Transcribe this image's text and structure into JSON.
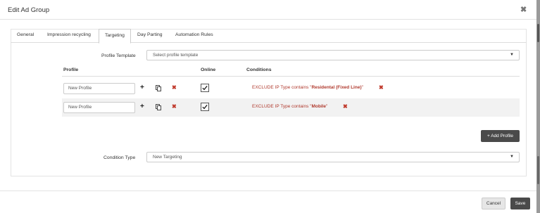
{
  "modal": {
    "title": "Edit Ad Group",
    "close_glyph": "✖"
  },
  "tabs": [
    {
      "label": "General"
    },
    {
      "label": "Impression recycling"
    },
    {
      "label": "Targeting"
    },
    {
      "label": "Day Parting"
    },
    {
      "label": "Automation Rules"
    }
  ],
  "active_tab": "Targeting",
  "profile_template": {
    "label": "Profile Template",
    "placeholder": "Select profile template"
  },
  "table": {
    "headers": {
      "profile": "Profile",
      "online": "Online",
      "conditions": "Conditions"
    },
    "rows": [
      {
        "profile_value": "New Profile",
        "online": true,
        "condition_prefix": "EXCLUDE IP Type contains \"",
        "condition_value": "Residental (Fixed Line)",
        "condition_suffix": "\""
      },
      {
        "profile_value": "New Profile",
        "online": true,
        "condition_prefix": "EXCLUDE IP Type contains \"",
        "condition_value": "Mobile",
        "condition_suffix": "\""
      }
    ]
  },
  "add_profile_button": {
    "label": "+ Add Profile"
  },
  "condition_type": {
    "label": "Condition Type",
    "value": "New Targeting"
  },
  "footer": {
    "cancel_label": "Cancel",
    "save_label": "Save"
  },
  "colors": {
    "accent_dark": "#4a4a4a",
    "condition_red": "#b03a2e",
    "delete_red": "#c0392b"
  },
  "icons": {
    "add": "plus-icon",
    "copy": "copy-icon",
    "delete": "delete-icon",
    "checkbox": "checkbox-checked-icon",
    "caret": "caret-down-icon"
  }
}
